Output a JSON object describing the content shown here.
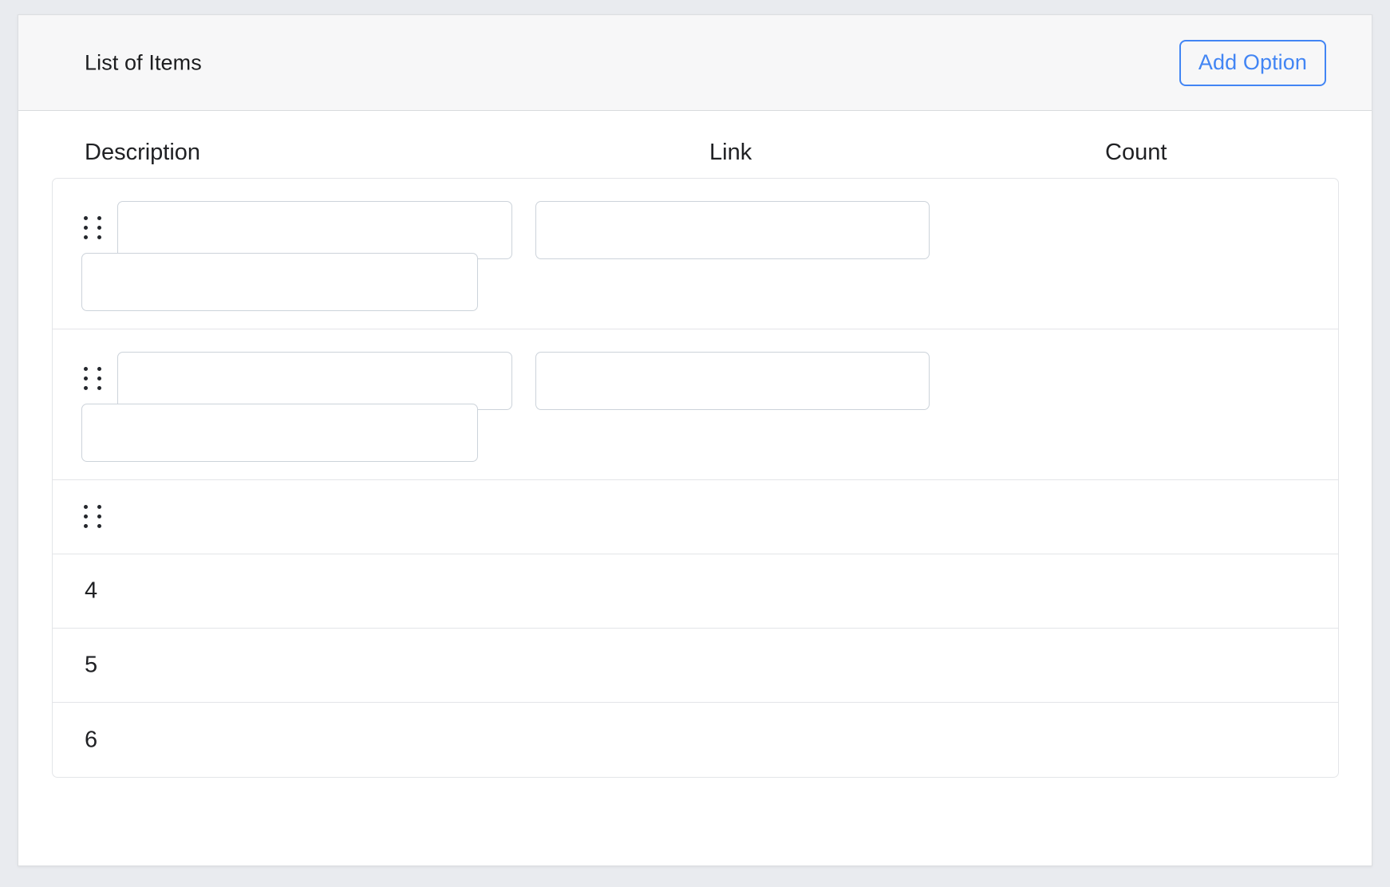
{
  "header": {
    "title": "List of Items",
    "add_option_label": "Add Option"
  },
  "table": {
    "columns": [
      {
        "key": "description",
        "label": "Description"
      },
      {
        "key": "link",
        "label": "Link"
      },
      {
        "key": "count",
        "label": "Count"
      }
    ],
    "rows": [
      {
        "kind": "editable",
        "drag_handle": "drag-handle-icon",
        "description_value": "",
        "description_placeholder": "",
        "description_sub_value": "",
        "description_sub_placeholder": "",
        "link_value": "",
        "link_placeholder": "",
        "count_value": ""
      },
      {
        "kind": "editable",
        "drag_handle": "drag-handle-icon",
        "description_value": "",
        "description_placeholder": "",
        "description_sub_value": "",
        "description_sub_placeholder": "",
        "link_value": "",
        "link_placeholder": "",
        "count_value": ""
      },
      {
        "kind": "handle-only",
        "drag_handle": "drag-handle-icon"
      },
      {
        "kind": "plain",
        "label": "4"
      },
      {
        "kind": "plain",
        "label": "5"
      },
      {
        "kind": "plain",
        "label": "6"
      }
    ]
  },
  "colors": {
    "accent": "#4285f4",
    "page_background": "#e9ebef",
    "card_background": "#ffffff",
    "card_header_background": "#f7f7f8",
    "border": "#e3e5e8",
    "input_border": "#ccd3da",
    "text": "#202124",
    "handle_dot": "#24272c"
  }
}
